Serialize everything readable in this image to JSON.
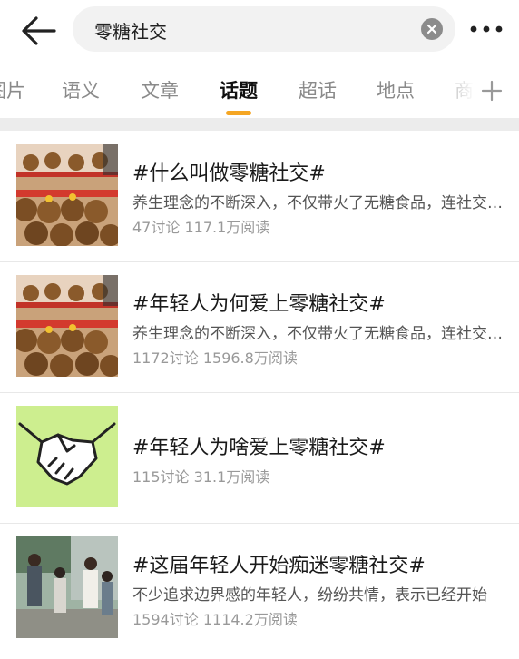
{
  "search": {
    "query": "零糖社交"
  },
  "tabs": [
    {
      "label": "图片"
    },
    {
      "label": "语义"
    },
    {
      "label": "文章"
    },
    {
      "label": "话题"
    },
    {
      "label": "超话"
    },
    {
      "label": "地点"
    },
    {
      "label": "商"
    }
  ],
  "active_tab": "话题",
  "accent_color": "#f5a623",
  "topics": [
    {
      "title": "#什么叫做零糖社交#",
      "desc": "养生理念的不断深入，不仅带火了无糖食品，连社交也开始无糖化",
      "discussions": "47讨论",
      "reads": "117.1万阅读",
      "thumb_icon": "plush-toys-image"
    },
    {
      "title": "#年轻人为何爱上零糖社交#",
      "desc": "养生理念的不断深入，不仅带火了无糖食品，连社交也开始无糖化",
      "discussions": "1172讨论",
      "reads": "1596.8万阅读",
      "thumb_icon": "plush-toys-image"
    },
    {
      "title": "#年轻人为啥爱上零糖社交#",
      "desc": "",
      "discussions": "115讨论",
      "reads": "31.1万阅读",
      "thumb_icon": "handshake-icon"
    },
    {
      "title": "#这届年轻人开始痴迷零糖社交#",
      "desc": "不少追求边界感的年轻人，纷纷共情，表示已经开始",
      "discussions": "1594讨论",
      "reads": "1114.2万阅读",
      "thumb_icon": "people-photo-image"
    }
  ]
}
